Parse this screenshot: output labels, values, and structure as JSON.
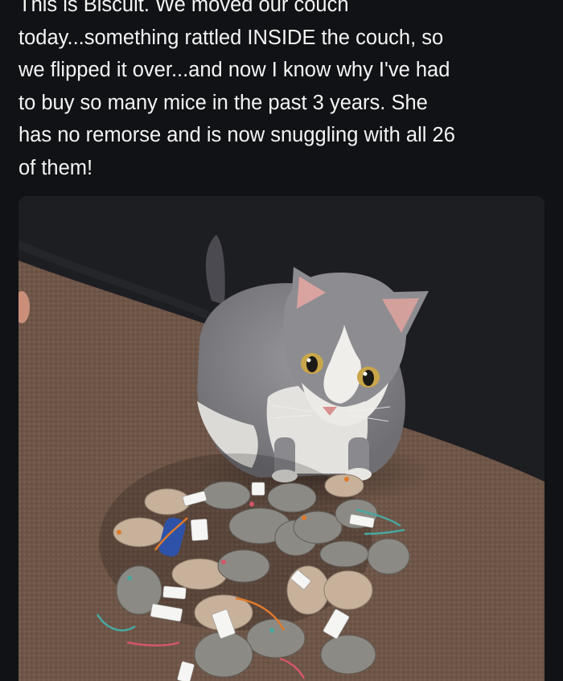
{
  "post": {
    "text": "This is Biscuit. We moved our couch\ntoday...something rattled INSIDE the couch, so\nwe flipped it over...and now I know why I've had\nto buy so many mice in the past 3 years. She\nhas no remorse and is now snuggling with all 26\nof them!"
  },
  "photo": {
    "subject": "gray-and-white-cat-with-toy-mice",
    "colors": {
      "couch": "#1d1e22",
      "carpet": "#6e5648",
      "cat_gray": "#85848a",
      "cat_white": "#e8e6e2"
    }
  }
}
